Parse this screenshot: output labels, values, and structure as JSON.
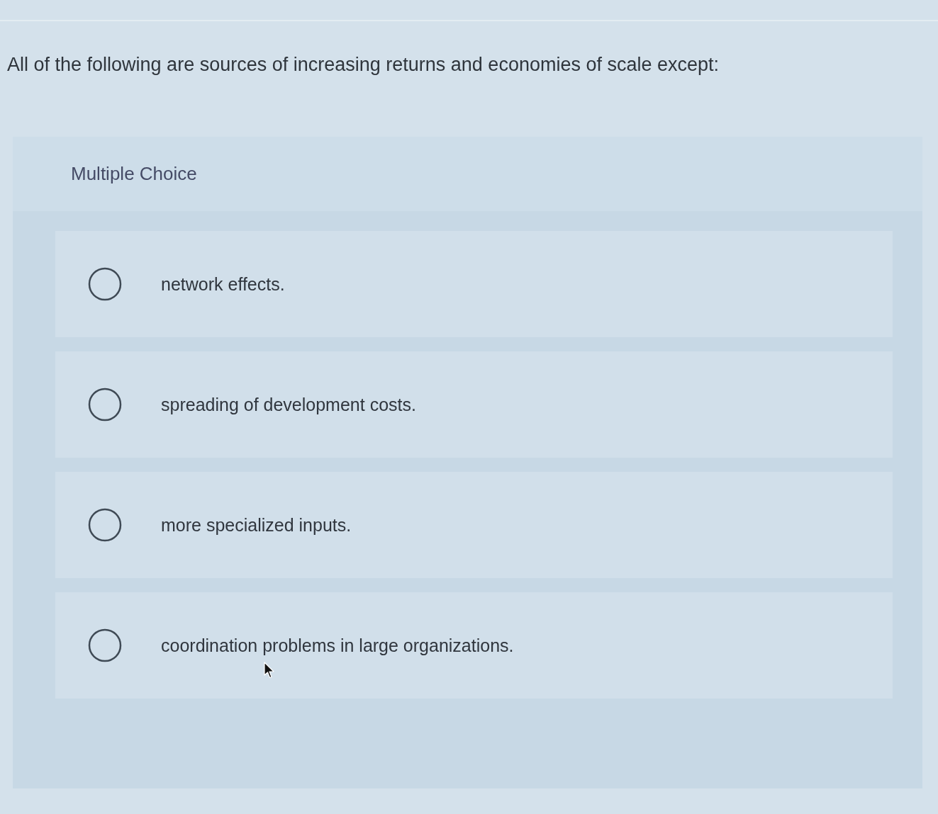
{
  "question": {
    "prompt": "All of the following are sources of increasing returns and economies of scale except:"
  },
  "answer_panel": {
    "type_label": "Multiple Choice",
    "options": [
      {
        "text": "network effects.",
        "selected": false
      },
      {
        "text": "spreading of development costs.",
        "selected": false
      },
      {
        "text": "more specialized inputs.",
        "selected": false
      },
      {
        "text": "coordination problems in large organizations.",
        "selected": false
      }
    ]
  }
}
